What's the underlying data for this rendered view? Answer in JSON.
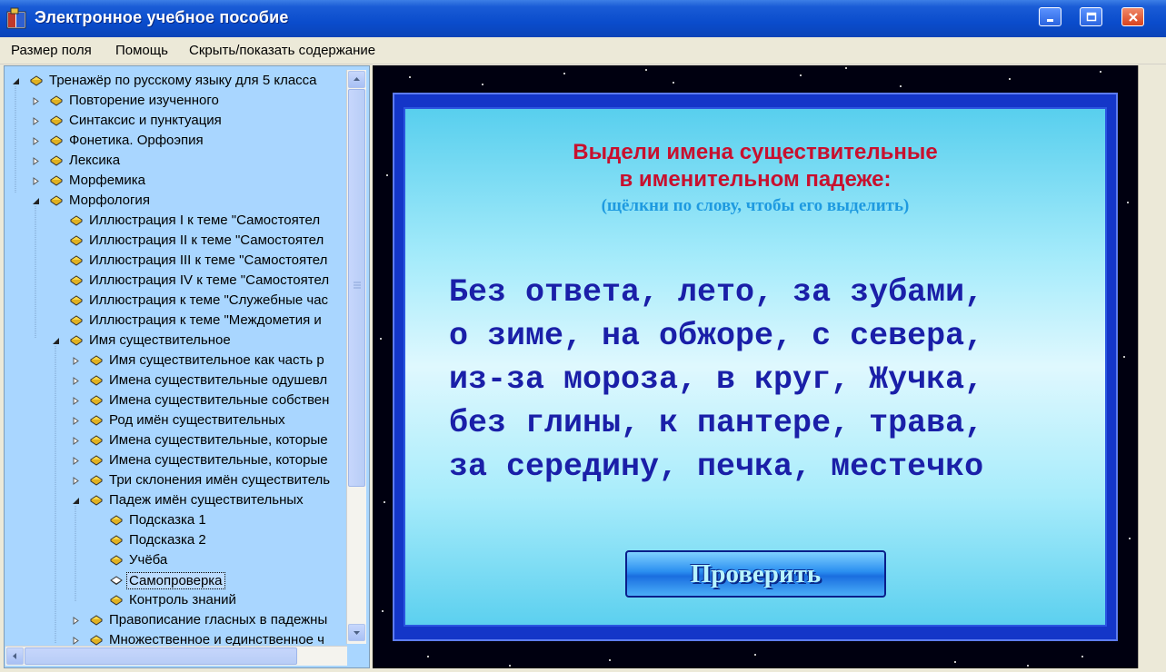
{
  "window": {
    "title": "Электронное учебное пособие",
    "controls": {
      "minimize": "minimize",
      "maximize": "maximize",
      "close": "close"
    }
  },
  "menu": {
    "items": [
      "Размер поля",
      "Помощь",
      "Скрыть/показать содержание"
    ]
  },
  "tree": {
    "items": [
      {
        "label": "Тренажёр по русскому языку для 5 класса",
        "level": 0,
        "state": "expanded"
      },
      {
        "label": "Повторение изученного",
        "level": 1,
        "state": "collapsed"
      },
      {
        "label": "Синтаксис и пунктуация",
        "level": 1,
        "state": "collapsed"
      },
      {
        "label": "Фонетика. Орфоэпия",
        "level": 1,
        "state": "collapsed"
      },
      {
        "label": "Лексика",
        "level": 1,
        "state": "collapsed"
      },
      {
        "label": "Морфемика",
        "level": 1,
        "state": "collapsed"
      },
      {
        "label": "Морфология",
        "level": 1,
        "state": "expanded"
      },
      {
        "label": "Иллюстрация I к теме \"Самостоятел",
        "level": 2,
        "state": "leaf"
      },
      {
        "label": "Иллюстрация II к теме \"Самостоятел",
        "level": 2,
        "state": "leaf"
      },
      {
        "label": "Иллюстрация III к теме \"Самостоятел",
        "level": 2,
        "state": "leaf"
      },
      {
        "label": "Иллюстрация IV к теме \"Самостоятел",
        "level": 2,
        "state": "leaf"
      },
      {
        "label": "Иллюстрация к теме \"Служебные час",
        "level": 2,
        "state": "leaf"
      },
      {
        "label": "Иллюстрация к теме \"Междометия и",
        "level": 2,
        "state": "leaf"
      },
      {
        "label": "Имя существительное",
        "level": 2,
        "state": "expanded"
      },
      {
        "label": "Имя существительное как часть р",
        "level": 3,
        "state": "collapsed"
      },
      {
        "label": "Имена существительные одушевл",
        "level": 3,
        "state": "collapsed"
      },
      {
        "label": "Имена существительные собствен",
        "level": 3,
        "state": "collapsed"
      },
      {
        "label": "Род имён существительных",
        "level": 3,
        "state": "collapsed"
      },
      {
        "label": "Имена существительные, которые",
        "level": 3,
        "state": "collapsed"
      },
      {
        "label": "Имена существительные, которые",
        "level": 3,
        "state": "collapsed"
      },
      {
        "label": "Три склонения имён существитель",
        "level": 3,
        "state": "collapsed"
      },
      {
        "label": "Падеж имён существительных",
        "level": 3,
        "state": "expanded"
      },
      {
        "label": "Подсказка 1",
        "level": 4,
        "state": "leaf"
      },
      {
        "label": "Подсказка 2",
        "level": 4,
        "state": "leaf"
      },
      {
        "label": "Учёба",
        "level": 4,
        "state": "leaf"
      },
      {
        "label": "Самопроверка",
        "level": 4,
        "state": "leaf-open",
        "selected": true
      },
      {
        "label": "Контроль знаний",
        "level": 4,
        "state": "leaf"
      },
      {
        "label": "Правописание гласных в падежны",
        "level": 3,
        "state": "collapsed"
      },
      {
        "label": "Множественное и единственное ч",
        "level": 3,
        "state": "collapsed"
      }
    ]
  },
  "exercise": {
    "instruction_line1": "Выдели имена существительные",
    "instruction_line2": "в именительном падеже:",
    "hint": "(щёлкни по слову, чтобы его выделить)",
    "lines": [
      "Без ответа, лето, за зубами,",
      "о зиме, на обжоре, с севера,",
      "из-за мороза, в круг, Жучка,",
      "без глины, к пантере, трава,",
      "за середину, печка, местечко"
    ],
    "check_button": "Проверить"
  },
  "colors": {
    "titlebar": "#0a4ccc",
    "tree_bg": "#a9d6ff",
    "instruction": "#c8102e",
    "hint": "#1e9ae0",
    "words": "#1a1fa8",
    "card_frame": "#1436c8"
  }
}
